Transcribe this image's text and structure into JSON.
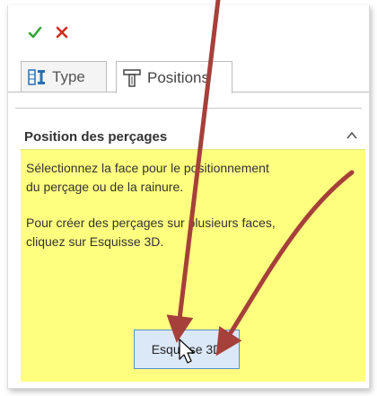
{
  "toolbar": {
    "ok_icon": "checkmark-icon",
    "cancel_icon": "cross-icon",
    "colors": {
      "ok": "#2da831",
      "cancel": "#d32a1f"
    }
  },
  "tabs": [
    {
      "label": "Type",
      "icon": "hole-type-icon"
    },
    {
      "label": "Positions",
      "icon": "hole-position-icon",
      "active": true
    }
  ],
  "section": {
    "title": "Position des perçages",
    "collapse_icon": "chevron-up-icon"
  },
  "info": {
    "lines": [
      "Sélectionnez la face pour le positionnement",
      "du perçage ou de la rainure.",
      "Pour créer des perçages sur plusieurs faces,",
      "cliquez sur Esquisse 3D."
    ],
    "background": "#ffff7f"
  },
  "button_3d": {
    "label": "Esquisse 3D"
  },
  "annotations": {
    "arrow_color": "#a6403a"
  }
}
